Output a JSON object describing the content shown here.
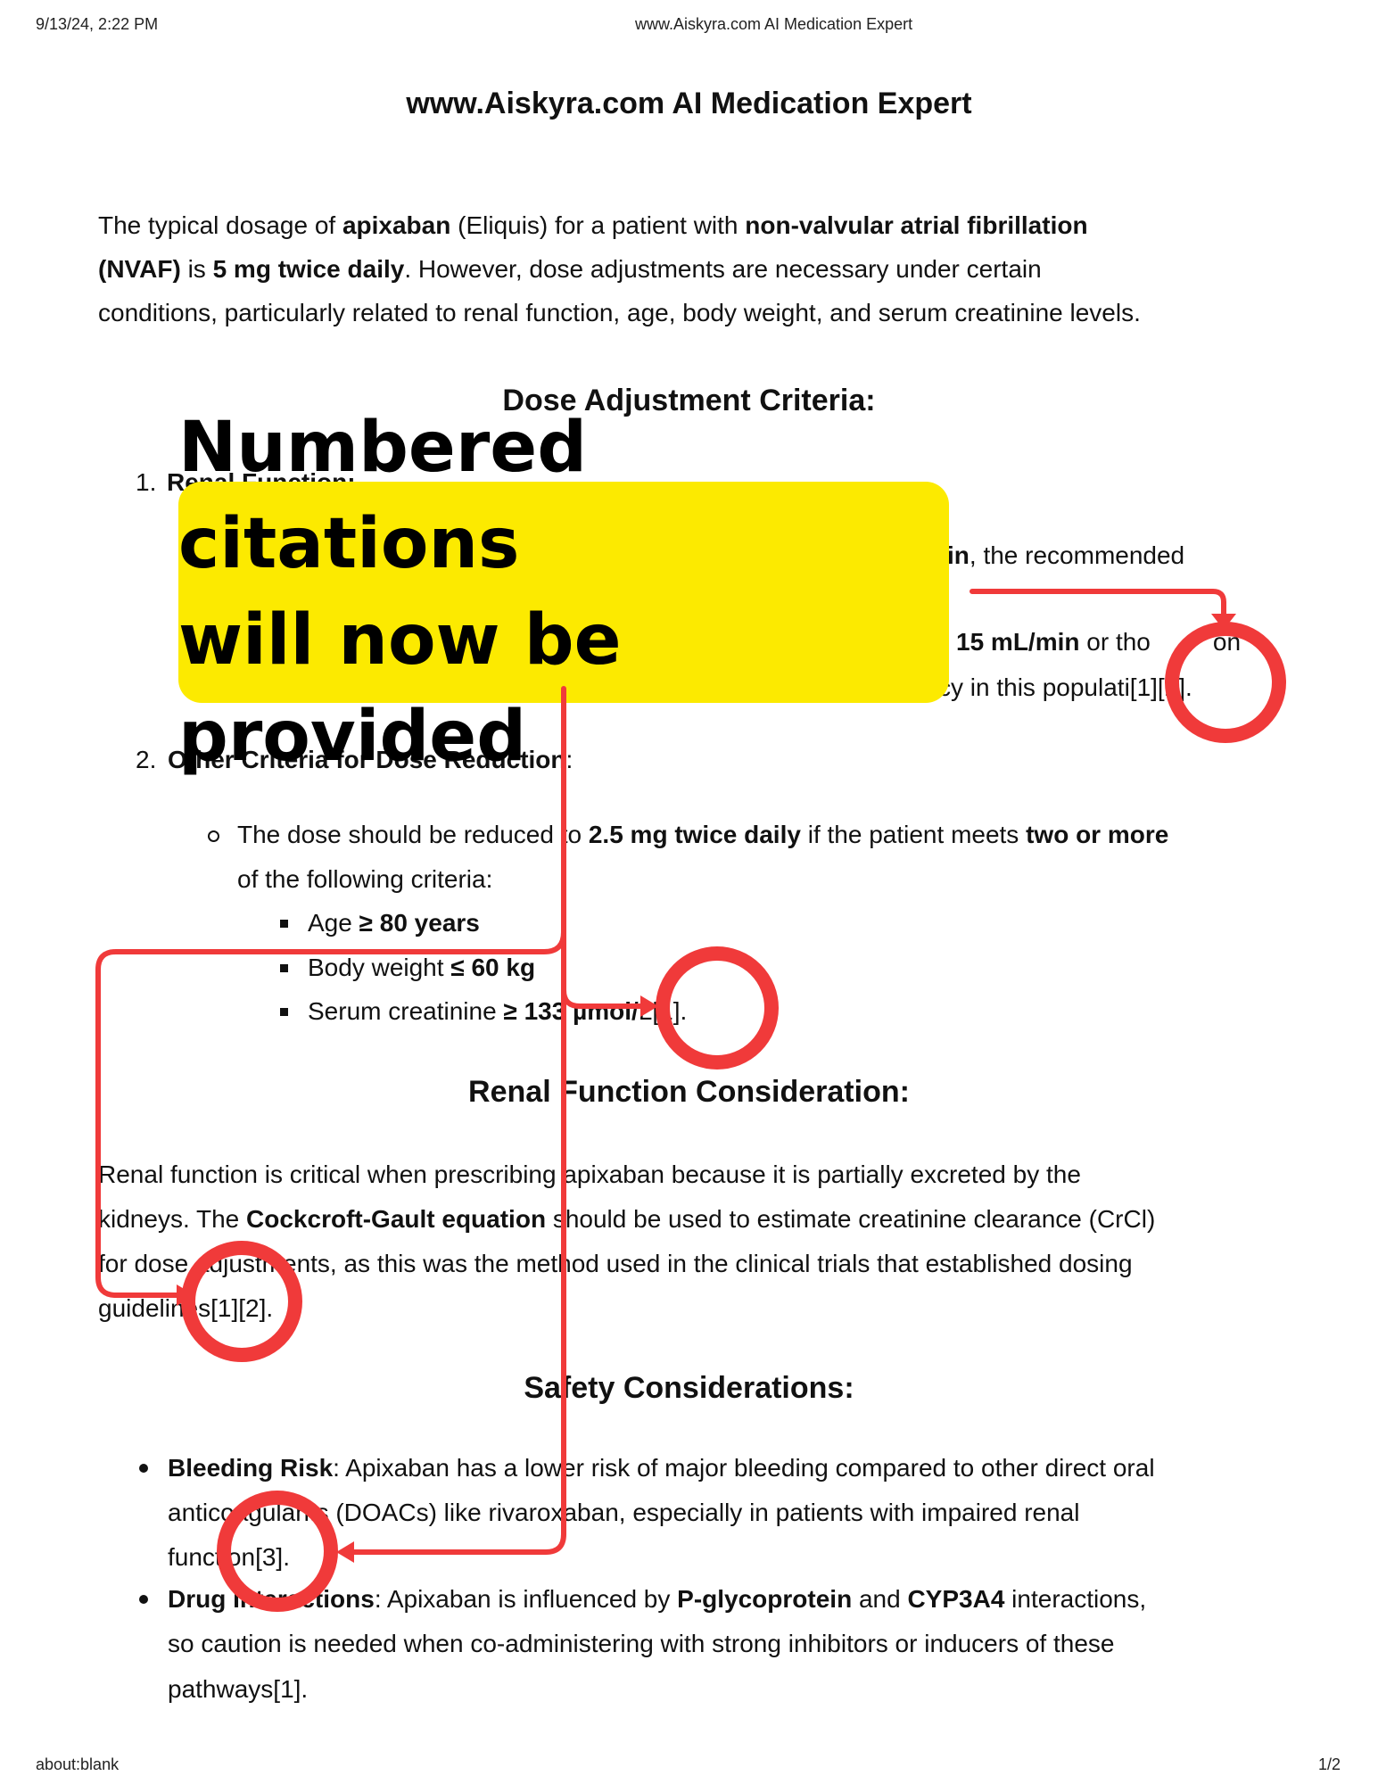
{
  "browser_header": {
    "datetime": "9/13/24, 2:22 PM",
    "page_title": "www.Aiskyra.com AI Medication Expert"
  },
  "browser_footer": {
    "url": "about:blank",
    "page_number": "1/2"
  },
  "document": {
    "title": "www.Aiskyra.com AI Medication Expert",
    "intro": {
      "l1_a": "The typical dosage of ",
      "l1_b": "apixaban",
      "l1_c": " (Eliquis) for a patient with ",
      "l1_d": "non-valvular atrial fibrillation",
      "l2_a": "(NVAF)",
      "l2_b": " is ",
      "l2_c": "5 mg twice daily",
      "l2_d": ". However, dose adjustments are necessary under certain",
      "l3": "conditions, particularly related to renal function, age, body weight, and serum creatinine levels."
    },
    "dose_heading": "Dose Adjustment Criteria:",
    "item1": {
      "number": "1.",
      "label_visible": "Re",
      "label_under": "nal Function:",
      "line_a_bold": "in",
      "line_a": ", the recommended",
      "line_b_bold": "15 mL/min",
      "line_b": " or tho",
      "line_b_tail": "on",
      "line_c": "cy in this populati",
      "line_c_cite": "[1][2]."
    },
    "item2": {
      "number": "2.",
      "label": "Other Criteria for Dose Reduction",
      "colon": ":",
      "sub_a": "The dose should be reduced to ",
      "sub_b": "2.5 mg twice daily",
      "sub_c": " if the patient meets ",
      "sub_d": "two or more",
      "sub_e": "of the following criteria:",
      "crit1_a": "Age ",
      "crit1_b": "≥ 80 years",
      "crit2_a": "Body weight ",
      "crit2_b": "≤ 60 kg",
      "crit3_a": "Serum creatinine ",
      "crit3_b": "≥ 133 µmol/",
      "crit3_c": "L[1]."
    },
    "renal_heading": "Renal Function Consideration:",
    "renal": {
      "l1": "Renal function is critical when prescribing apixaban because it is partially excreted by the",
      "l2_a": "kidneys. The ",
      "l2_b": "Cockcroft-Gault equation",
      "l2_c": " should be used to estimate creatinine clearance (CrCl)",
      "l3": "for dose adjustments, as this was the method used in the clinical trials that established dosing",
      "l4": "guidelines[1][2]."
    },
    "safety_heading": "Safety Considerations:",
    "safety": {
      "b1_label": "Bleeding Risk",
      "b1_l1": ": Apixaban has a lower risk of major bleeding compared to other direct oral",
      "b1_l2": "anticoagulants (DOACs) like rivaroxaban, especially in patients with impaired renal",
      "b1_l3": "function[3].",
      "b2_label": "Drug Interactions",
      "b2_l1_a": ": Apixaban is influenced by ",
      "b2_l1_b": "P-glycoprotein",
      "b2_l1_c": " and ",
      "b2_l1_d": "CYP3A4",
      "b2_l1_e": " interactions,",
      "b2_l2": "so caution is needed when co-administering with strong inhibitors or inducers of these",
      "b2_l3": "pathways[1]."
    }
  },
  "callout": {
    "line1": "Numbered citations",
    "line2": "will now be provided",
    "background": "#FCEA00",
    "annotation_color": "#F03A3A"
  }
}
